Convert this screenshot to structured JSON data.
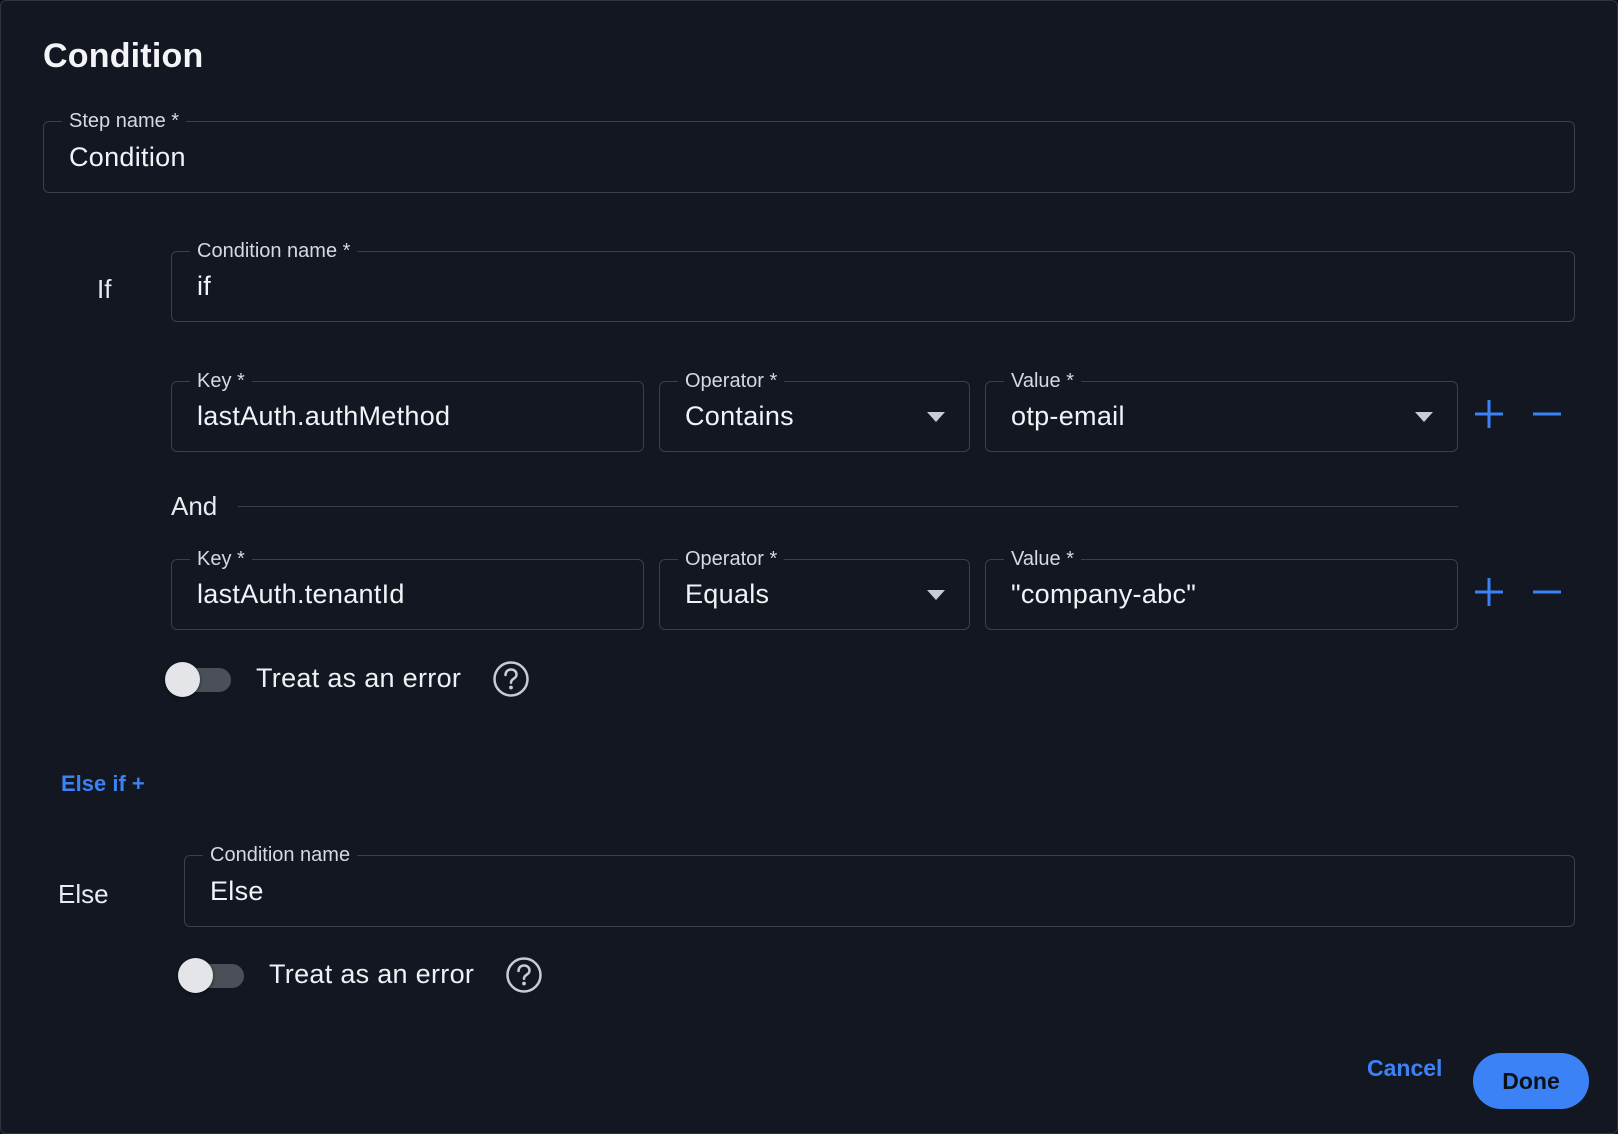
{
  "dialog": {
    "title": "Condition"
  },
  "step": {
    "label": "Step name *",
    "value": "Condition"
  },
  "if_block": {
    "section_label": "If",
    "condition_name_label": "Condition name *",
    "condition_name_value": "if",
    "rows": [
      {
        "key_label": "Key *",
        "key_value": "lastAuth.authMethod",
        "operator_label": "Operator *",
        "operator_value": "Contains",
        "value_label": "Value *",
        "value_value": "otp-email"
      },
      {
        "key_label": "Key *",
        "key_value": "lastAuth.tenantId",
        "operator_label": "Operator *",
        "operator_value": "Equals",
        "value_label": "Value *",
        "value_value": "\"company-abc\""
      }
    ],
    "joiner": "And",
    "treat_as_error_label": "Treat as an error",
    "treat_as_error_on": false
  },
  "else_if_link": "Else if +",
  "else_block": {
    "section_label": "Else",
    "condition_name_label": "Condition name",
    "condition_name_value": "Else",
    "treat_as_error_label": "Treat as an error",
    "treat_as_error_on": false
  },
  "footer": {
    "cancel_label": "Cancel",
    "done_label": "Done"
  },
  "colors": {
    "accent": "#3b82f6",
    "background": "#121722",
    "border": "#3a404b"
  }
}
